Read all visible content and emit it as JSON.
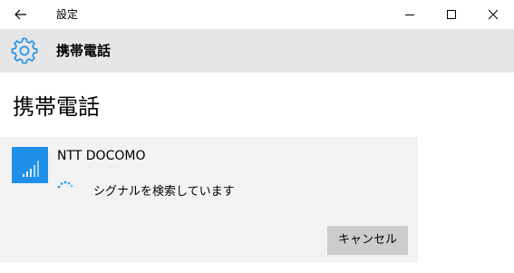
{
  "window": {
    "title": "設定",
    "back_icon": "arrow-left-icon",
    "controls": [
      "minimize-icon",
      "maximize-icon",
      "close-icon"
    ]
  },
  "header": {
    "icon": "gear-icon",
    "title": "携帯電話"
  },
  "page": {
    "title": "携帯電話"
  },
  "connection": {
    "carrier": "NTT DOCOMO",
    "status": "シグナルを検索しています",
    "cancel_label": "キャンセル",
    "icon": "cellular-signal-icon",
    "tile_color": "#1e90e8"
  },
  "colors": {
    "accent": "#1e90e8",
    "header_bg": "#e6e6e6",
    "card_bg": "#f2f2f2",
    "button_bg": "#cccccc"
  }
}
